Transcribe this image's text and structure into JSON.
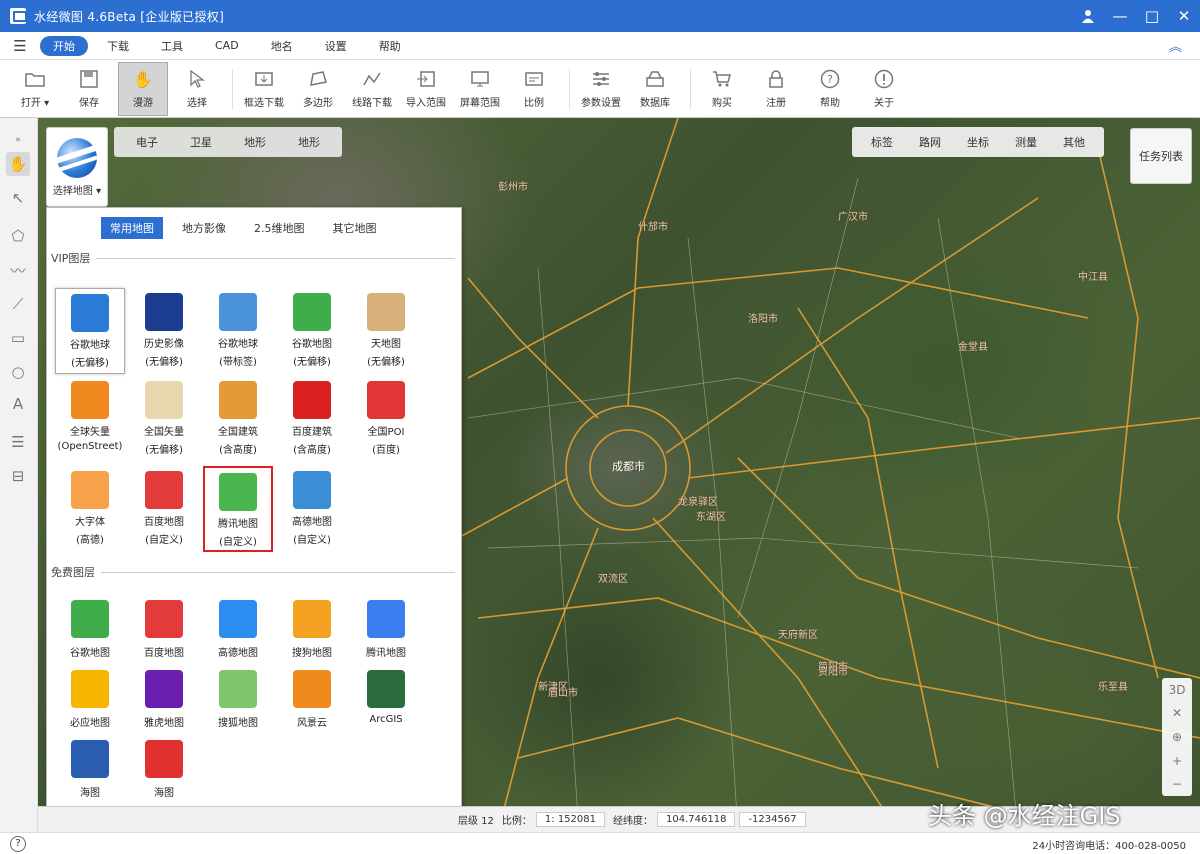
{
  "window": {
    "title": "水经微图 4.6Beta [企业版已授权]",
    "minimize": "—",
    "maximize": "□",
    "close": "✕",
    "user_icon": "user-icon"
  },
  "menu": {
    "items": [
      "开始",
      "下载",
      "工具",
      "CAD",
      "地名",
      "设置",
      "帮助"
    ],
    "active": 0
  },
  "toolbar": {
    "items": [
      {
        "label": "打开 ▾",
        "icon": "folder-icon"
      },
      {
        "label": "保存",
        "icon": "save-icon"
      },
      {
        "label": "漫游",
        "icon": "hand-icon"
      },
      {
        "label": "选择",
        "icon": "cursor-icon"
      },
      {
        "label": "框选下载",
        "icon": "frame-download-icon"
      },
      {
        "label": "多边形",
        "icon": "polygon-icon"
      },
      {
        "label": "线路下载",
        "icon": "line-download-icon"
      },
      {
        "label": "导入范围",
        "icon": "import-icon"
      },
      {
        "label": "屏幕范围",
        "icon": "screen-icon"
      },
      {
        "label": "比例",
        "icon": "scale-icon"
      },
      {
        "label": "参数设置",
        "icon": "settings-icon"
      },
      {
        "label": "数据库",
        "icon": "database-icon"
      },
      {
        "label": "购买",
        "icon": "cart-icon"
      },
      {
        "label": "注册",
        "icon": "lock-icon"
      },
      {
        "label": "帮助",
        "icon": "help-icon"
      },
      {
        "label": "关于",
        "icon": "info-icon"
      }
    ]
  },
  "map_tabs": [
    "电子",
    "卫星",
    "地形",
    "地形"
  ],
  "map_tools": [
    "标签",
    "路网",
    "坐标",
    "测量",
    "其他"
  ],
  "task_list": "任务列表",
  "selector": {
    "label": "选择地图 ▾"
  },
  "panel": {
    "tabs": [
      "常用地图",
      "地方影像",
      "2.5维地图",
      "其它地图"
    ],
    "active_tab": 0,
    "vip_title": "VIP图层",
    "vip_tiles": [
      {
        "name": "谷歌地球",
        "sub": "(无偏移)",
        "color": "#2a7bd6"
      },
      {
        "name": "历史影像",
        "sub": "(无偏移)",
        "color": "#1c3d8f"
      },
      {
        "name": "谷歌地球",
        "sub": "(带标签)",
        "color": "#4b93d8"
      },
      {
        "name": "谷歌地图",
        "sub": "(无偏移)",
        "color": "#3fae4a"
      },
      {
        "name": "天地图",
        "sub": "(无偏移)",
        "color": "#d8b07a"
      },
      {
        "name": "全球矢量",
        "sub": "(OpenStreet)",
        "color": "#f08a1e"
      },
      {
        "name": "全国矢量",
        "sub": "(无偏移)",
        "color": "#e9d7b0"
      },
      {
        "name": "全国建筑",
        "sub": "(含高度)",
        "color": "#e59a3a"
      },
      {
        "name": "百度建筑",
        "sub": "(含高度)",
        "color": "#d92020"
      },
      {
        "name": "全国POI",
        "sub": "(百度)",
        "color": "#e03636"
      },
      {
        "name": "大字体",
        "sub": "(高德)",
        "color": "#f7a24a"
      },
      {
        "name": "百度地图",
        "sub": "(自定义)",
        "color": "#e33a3a"
      },
      {
        "name": "腾讯地图",
        "sub": "(自定义)",
        "color": "#49b54c"
      },
      {
        "name": "高德地图",
        "sub": "(自定义)",
        "color": "#3b8ed6"
      }
    ],
    "free_title": "免费图层",
    "free_tiles": [
      {
        "name": "谷歌地图",
        "color": "#3fae4a"
      },
      {
        "name": "百度地图",
        "color": "#e33a3a"
      },
      {
        "name": "高德地图",
        "color": "#2d8cf0"
      },
      {
        "name": "搜狗地图",
        "color": "#f2a220"
      },
      {
        "name": "腾讯地图",
        "color": "#3b7ef0"
      },
      {
        "name": "必应地图",
        "color": "#f7b500"
      },
      {
        "name": "雅虎地图",
        "color": "#6a1fb0"
      },
      {
        "name": "搜狐地图",
        "color": "#7fc66a"
      },
      {
        "name": "风景云",
        "color": "#f08a1e"
      },
      {
        "name": "ArcGIS",
        "color": "#2b6b3d"
      },
      {
        "name": "海图",
        "color": "#2a5db0"
      },
      {
        "name": "海图",
        "color": "#e03030"
      }
    ]
  },
  "map_labels": [
    {
      "text": "成都市"
    },
    {
      "text": "洛阳市"
    },
    {
      "text": "东湖区"
    },
    {
      "text": "天府新区"
    },
    {
      "text": "简阳市"
    },
    {
      "text": "龙泉驿区"
    },
    {
      "text": "双流区"
    },
    {
      "text": "新津区"
    },
    {
      "text": "彭州市"
    },
    {
      "text": "什邡市"
    },
    {
      "text": "广汉市"
    },
    {
      "text": "金堂县"
    },
    {
      "text": "中江县"
    },
    {
      "text": "乐至县"
    },
    {
      "text": "资阳市"
    },
    {
      "text": "眉山市"
    }
  ],
  "map_controls": [
    "3D",
    "✕",
    "⊕",
    "+",
    "−"
  ],
  "status": {
    "layer": "层级 12",
    "scale_label": "比例：",
    "scale": "1: 152081",
    "coord_label": "经纬度：",
    "coord": "104.746118",
    "coord2": "-1234567"
  },
  "watermark": "头条 @水经注GIS",
  "hotline": "24小时咨询电话：400-028-0050"
}
